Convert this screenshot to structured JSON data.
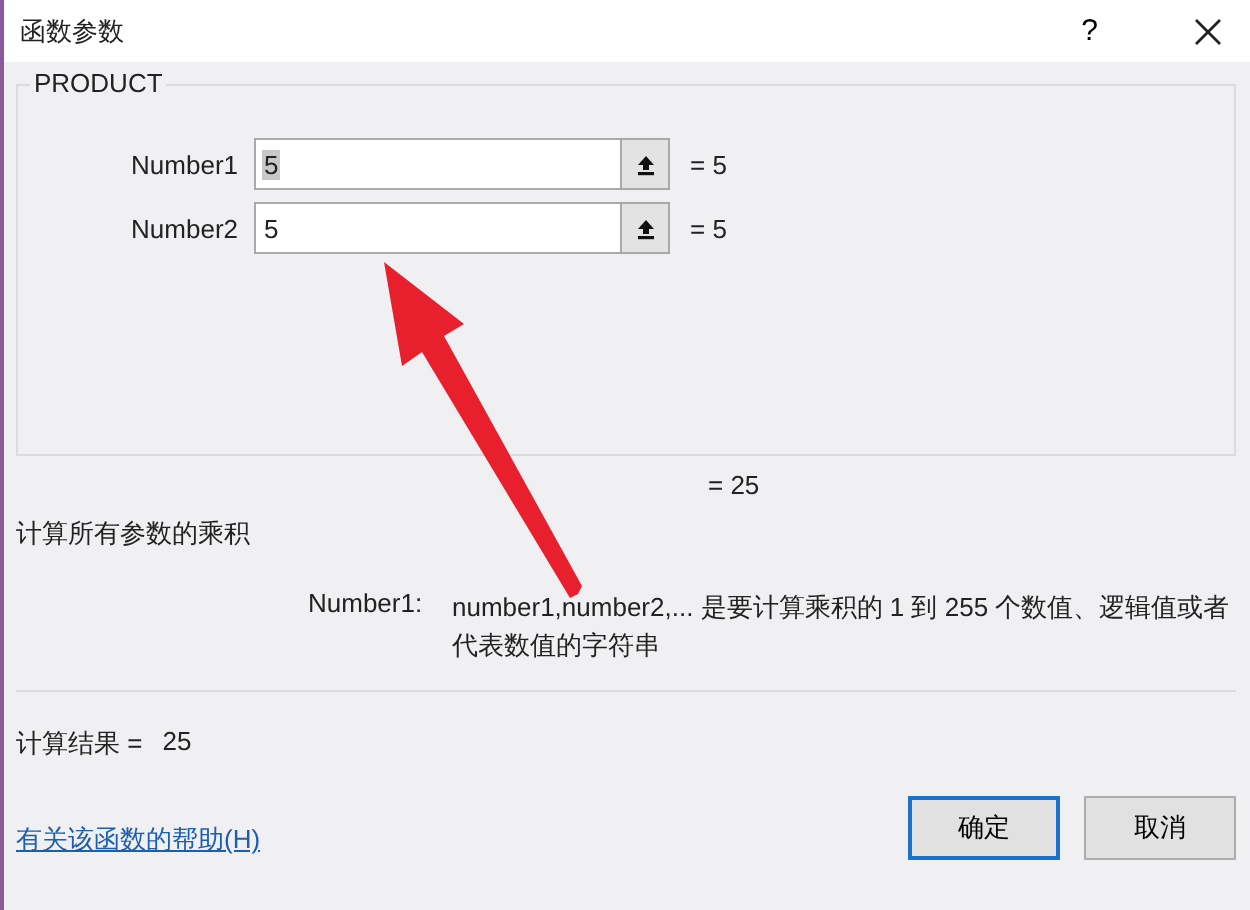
{
  "window": {
    "title": "函数参数",
    "help": "?"
  },
  "function": {
    "name": "PRODUCT",
    "args": [
      {
        "label": "Number1",
        "value": "5",
        "value_selected": true,
        "result": "= 5"
      },
      {
        "label": "Number2",
        "value": "5",
        "value_selected": false,
        "result": "= 5"
      }
    ],
    "result": "= 25"
  },
  "description": "计算所有参数的乘积",
  "arg_help": {
    "label": "Number1:",
    "text": "number1,number2,... 是要计算乘积的 1 到 255 个数值、逻辑值或者代表数值的字符串"
  },
  "calc_result": {
    "label": "计算结果 =",
    "value": "25"
  },
  "help_link": "有关该函数的帮助(H)",
  "buttons": [
    {
      "label": "确定",
      "default": true
    },
    {
      "label": "取消",
      "default": false
    }
  ],
  "annotation": {
    "kind": "arrow"
  }
}
